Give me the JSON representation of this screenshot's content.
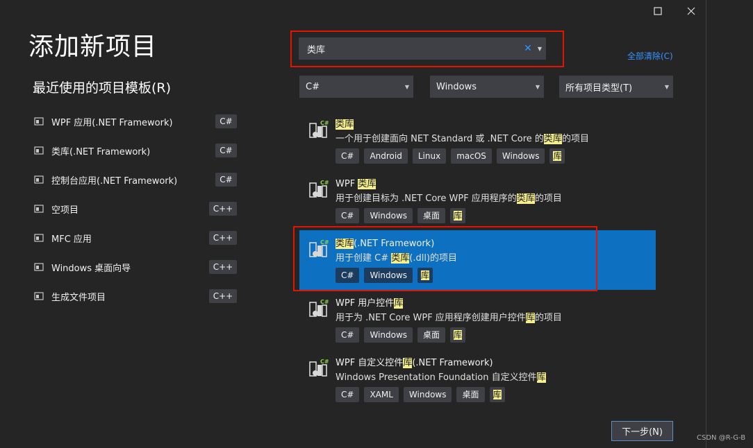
{
  "window": {
    "maximize_icon": "maximize-icon",
    "close_icon": "close-icon"
  },
  "header": {
    "title": "添加新项目",
    "recent_heading": "最近使用的项目模板(R)"
  },
  "recent_templates": [
    {
      "label": "WPF 应用(.NET Framework)",
      "lang": "C#",
      "icon": "wpf-app-icon"
    },
    {
      "label": "类库(.NET Framework)",
      "lang": "C#",
      "icon": "class-library-icon"
    },
    {
      "label": "控制台应用(.NET Framework)",
      "lang": "C#",
      "icon": "console-app-icon"
    },
    {
      "label": "空项目",
      "lang": "C++",
      "icon": "empty-project-icon"
    },
    {
      "label": "MFC 应用",
      "lang": "C++",
      "icon": "mfc-app-icon"
    },
    {
      "label": "Windows 桌面向导",
      "lang": "C++",
      "icon": "desktop-wizard-icon"
    },
    {
      "label": "生成文件项目",
      "lang": "C++",
      "icon": "makefile-project-icon"
    }
  ],
  "search": {
    "value": "类库",
    "clear_icon": "clear-icon",
    "dropdown_icon": "dropdown-arrow-icon"
  },
  "clear_all_label": "全部清除(C)",
  "filters": {
    "language": "C#",
    "platform": "Windows",
    "project_type": "所有项目类型(T)"
  },
  "templates": [
    {
      "name_parts": [
        "类库",
        ""
      ],
      "desc_parts": [
        "一个用于创建面向 NET Standard 或 .NET Core 的",
        "类库",
        "的项目"
      ],
      "tags": [
        "C#",
        "Android",
        "Linux",
        "macOS",
        "Windows"
      ],
      "lib_tag": "库",
      "icon": "class-library-icon"
    },
    {
      "name_prefix": "WPF ",
      "name_hl": "类库",
      "name_suffix": "",
      "desc_parts": [
        "用于创建目标为 .NET Core WPF 应用程序的",
        "类库",
        "的项目"
      ],
      "tags": [
        "C#",
        "Windows",
        "桌面"
      ],
      "lib_tag": "库",
      "icon": "wpf-library-icon"
    },
    {
      "name_prefix": "",
      "name_hl": "类库",
      "name_suffix": "(.NET Framework)",
      "desc_parts": [
        "用于创建 C# ",
        "类库",
        "(.dll)的项目"
      ],
      "tags": [
        "C#",
        "Windows"
      ],
      "lib_tag": "库",
      "icon": "netfx-library-icon"
    },
    {
      "name_prefix": "WPF 用户控件",
      "name_hl": "库",
      "name_suffix": "",
      "desc_parts": [
        "用于为 .NET Core WPF 应用程序创建用户控件",
        "库",
        "的项目"
      ],
      "tags": [
        "C#",
        "Windows",
        "桌面"
      ],
      "lib_tag": "库",
      "icon": "user-control-library-icon"
    },
    {
      "name_prefix": "WPF 自定义控件",
      "name_hl": "库",
      "name_suffix": "(.NET Framework)",
      "desc_parts": [
        "Windows Presentation Foundation 自定义控件",
        "库",
        ""
      ],
      "tags": [
        "C#",
        "XAML",
        "Windows",
        "桌面"
      ],
      "lib_tag": "库",
      "icon": "custom-control-library-icon"
    }
  ],
  "next_button": "下一步(N)",
  "watermark": "CSDN @R-G-B"
}
